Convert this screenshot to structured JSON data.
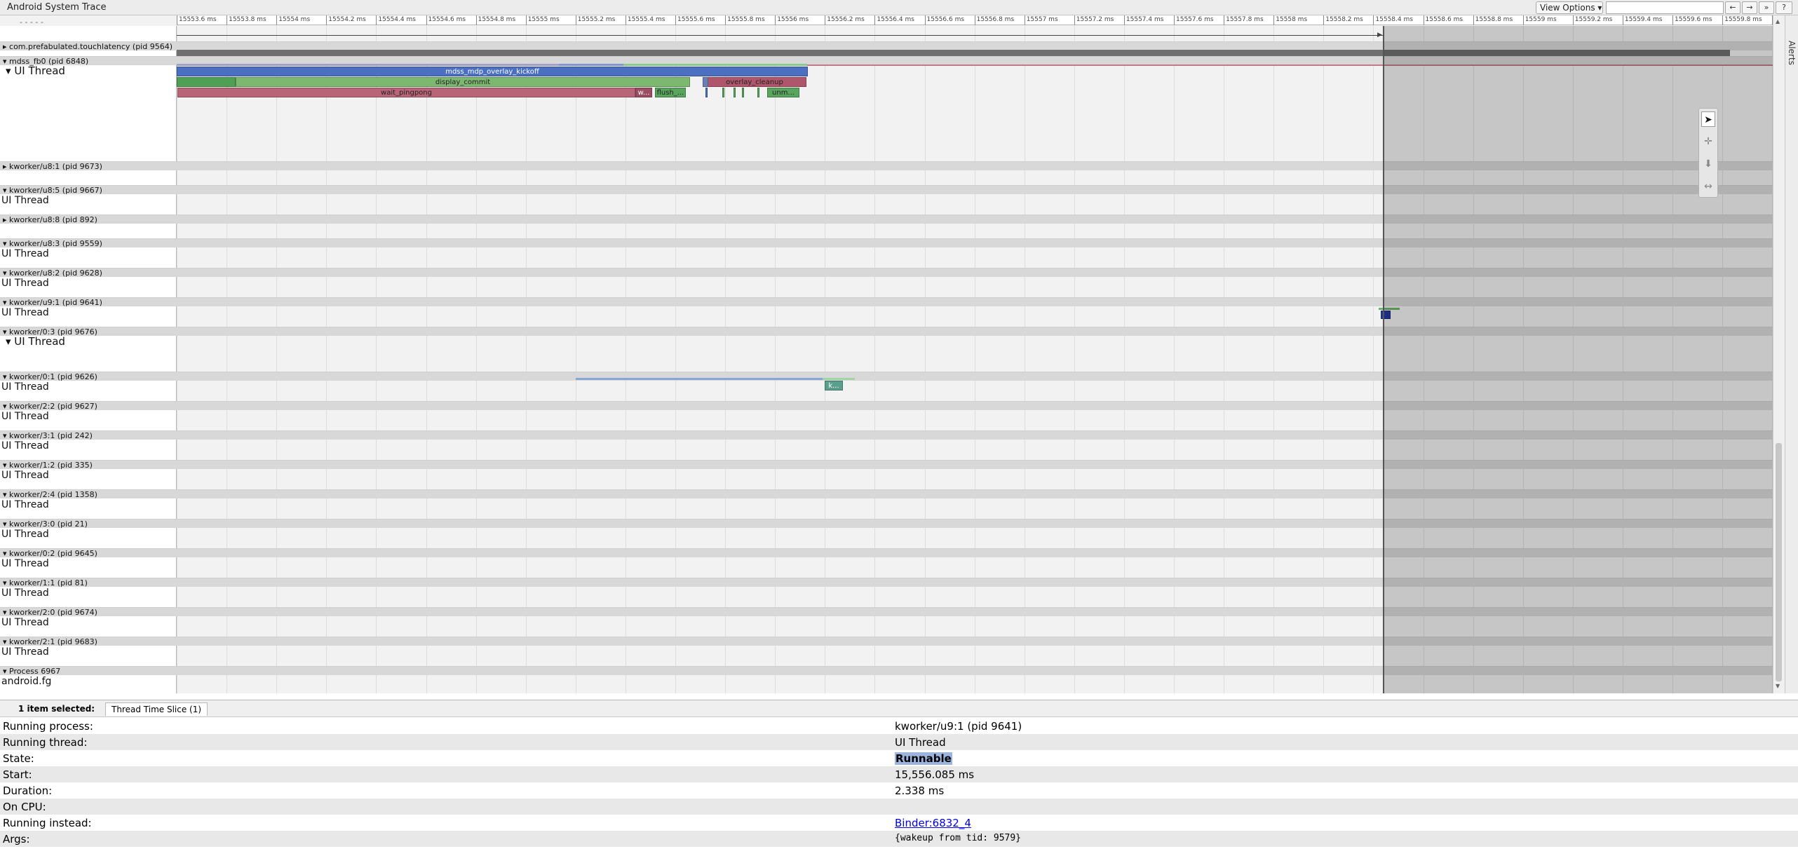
{
  "app": {
    "title": "Android System Trace"
  },
  "toolbar": {
    "view_options_label": "View Options ▾",
    "search_placeholder": "",
    "nav_buttons": [
      "←",
      "→",
      "»",
      "?"
    ]
  },
  "ruler": {
    "ticks": [
      "15553.6 ms",
      "15553.8 ms",
      "15554 ms",
      "15554.2 ms",
      "15554.4 ms",
      "15554.6 ms",
      "15554.8 ms",
      "15555 ms",
      "15555.2 ms",
      "15555.4 ms",
      "15555.6 ms",
      "15555.8 ms",
      "15556 ms",
      "15556.2 ms",
      "15556.4 ms",
      "15556.6 ms",
      "15556.8 ms",
      "15557 ms",
      "15557.2 ms",
      "15557.4 ms",
      "15557.6 ms",
      "15557.8 ms",
      "15558 ms",
      "15558.2 ms",
      "15558.4 ms",
      "15558.6 ms",
      "15558.8 ms",
      "15559 ms",
      "15559.2 ms",
      "15559.4 ms",
      "15559.6 ms",
      "15559.8 ms",
      "155"
    ]
  },
  "tracks": {
    "partial_top_label": "- - - - -",
    "touchlatency": {
      "label": "com.prefabulated.touchlatency (pid 9564)"
    },
    "mdss": {
      "label": "mdss_fb0 (pid 6848)",
      "thread": "UI Thread",
      "slices": [
        {
          "label": "mdss_mdp_overlay_kickoff"
        },
        {
          "label": "display_commit"
        },
        {
          "label": "overlay_cleanup"
        },
        {
          "label": "wait_pingpong"
        },
        {
          "label": "w..."
        },
        {
          "label": "flush_..."
        },
        {
          "label": "unm..."
        }
      ]
    },
    "processes": [
      {
        "label": "kworker/u8:1 (pid 9673)",
        "thread": ""
      },
      {
        "label": "kworker/u8:5 (pid 9667)",
        "thread": "UI Thread"
      },
      {
        "label": "kworker/u8:8 (pid 892)",
        "thread": ""
      },
      {
        "label": "kworker/u8:3 (pid 9559)",
        "thread": "UI Thread"
      },
      {
        "label": "kworker/u8:2 (pid 9628)",
        "thread": "UI Thread"
      },
      {
        "label": "kworker/u9:1 (pid 9641)",
        "thread": "UI Thread"
      },
      {
        "label": "kworker/0:3 (pid 9676)",
        "thread": "UI Thread"
      },
      {
        "label": "kworker/0:1 (pid 9626)",
        "thread": "UI Thread"
      },
      {
        "label": "kworker/2:2 (pid 9627)",
        "thread": "UI Thread"
      },
      {
        "label": "kworker/3:1 (pid 242)",
        "thread": "UI Thread"
      },
      {
        "label": "kworker/1:2 (pid 335)",
        "thread": "UI Thread"
      },
      {
        "label": "kworker/2:4 (pid 1358)",
        "thread": "UI Thread"
      },
      {
        "label": "kworker/3:0 (pid 21)",
        "thread": "UI Thread"
      },
      {
        "label": "kworker/0:2 (pid 9645)",
        "thread": "UI Thread"
      },
      {
        "label": "kworker/1:1 (pid 81)",
        "thread": "UI Thread"
      },
      {
        "label": "kworker/2:0 (pid 9674)",
        "thread": "UI Thread"
      },
      {
        "label": "kworker/2:1 (pid 9683)",
        "thread": "UI Thread"
      },
      {
        "label": "Process 6967",
        "thread": "android.fg"
      }
    ],
    "kworker01_slice": "k..."
  },
  "alerts": {
    "label": "Alerts"
  },
  "selection": {
    "count_label": "1 item selected:",
    "tab_label": "Thread Time Slice (1)",
    "rows": [
      {
        "key": "Running process:",
        "value": "kworker/u9:1 (pid 9641)"
      },
      {
        "key": "Running thread:",
        "value": "UI Thread"
      },
      {
        "key": "State:",
        "value": "Runnable"
      },
      {
        "key": "Start:",
        "value": "15,556.085 ms"
      },
      {
        "key": "Duration:",
        "value": "2.338 ms"
      },
      {
        "key": "On CPU:",
        "value": ""
      },
      {
        "key": "Running instead:",
        "value": "Binder:6832_4"
      },
      {
        "key": "Args:",
        "value": "{wakeup from tid: 9579}"
      }
    ]
  },
  "colors": {
    "selection_shade": "#000000",
    "slice_blue": "#3f63b1",
    "slice_green": "#6daa62",
    "slice_red": "#a8566a",
    "runnable": "#9bb5de"
  }
}
